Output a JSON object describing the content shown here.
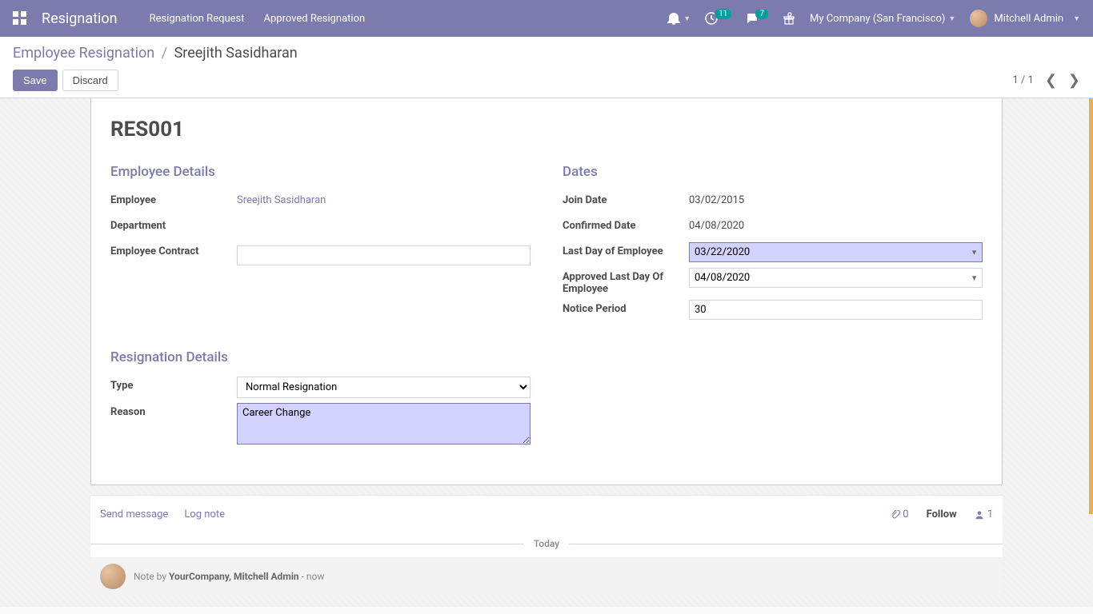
{
  "navbar": {
    "app_title": "Resignation",
    "links": [
      "Resignation Request",
      "Approved Resignation"
    ],
    "activity_badge": "11",
    "chat_badge": "7",
    "company": "My Company (San Francisco)",
    "user": "Mitchell Admin"
  },
  "breadcrumb": {
    "parent": "Employee Resignation",
    "current": "Sreejith Sasidharan"
  },
  "cp": {
    "save": "Save",
    "discard": "Discard",
    "pager": "1 / 1"
  },
  "form": {
    "record_id": "RES001",
    "sections": {
      "employee_details": "Employee Details",
      "dates": "Dates",
      "resignation_details": "Resignation Details"
    },
    "labels": {
      "employee": "Employee",
      "department": "Department",
      "contract": "Employee Contract",
      "join_date": "Join Date",
      "confirmed_date": "Confirmed Date",
      "last_day": "Last Day of Employee",
      "approved_last_day": "Approved Last Day Of Employee",
      "notice_period": "Notice Period",
      "type": "Type",
      "reason": "Reason"
    },
    "values": {
      "employee": "Sreejith Sasidharan",
      "department": "",
      "contract": "",
      "join_date": "03/02/2015",
      "confirmed_date": "04/08/2020",
      "last_day": "03/22/2020",
      "approved_last_day": "04/08/2020",
      "notice_period": "30",
      "type": "Normal Resignation",
      "reason": "Career Change"
    }
  },
  "chatter": {
    "send_message": "Send message",
    "log_note": "Log note",
    "attachments": "0",
    "follow": "Follow",
    "followers": "1",
    "divider": "Today",
    "message_prefix": "Note by ",
    "message_author": "YourCompany, Mitchell Admin",
    "message_suffix": " - now"
  }
}
